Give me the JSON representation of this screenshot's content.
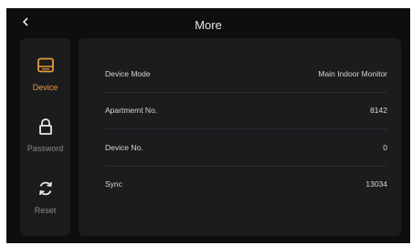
{
  "header": {
    "title": "More"
  },
  "sidebar": {
    "items": [
      {
        "label": "Device",
        "icon": "device-icon",
        "active": true
      },
      {
        "label": "Password",
        "icon": "lock-icon",
        "active": false
      },
      {
        "label": "Reset",
        "icon": "reset-icon",
        "active": false
      }
    ]
  },
  "info": {
    "rows": [
      {
        "label": "Device Mode",
        "value": "Main Indoor Monitor"
      },
      {
        "label": "Apartmemt No.",
        "value": "8142"
      },
      {
        "label": "Device No.",
        "value": "0"
      },
      {
        "label": "Sync",
        "value": "13034"
      }
    ]
  },
  "colors": {
    "accent": "#e09a3e",
    "background": "#0e0e10",
    "panel": "#1c1c1f",
    "text": "#d6d6d8",
    "muted": "#8a8a8d"
  }
}
